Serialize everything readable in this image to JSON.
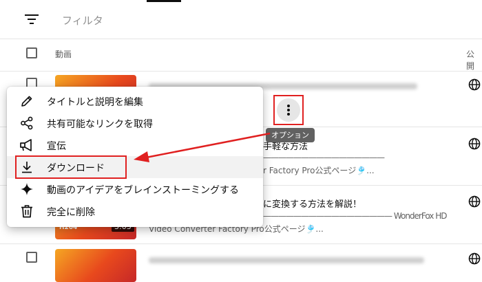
{
  "toolbar": {
    "filter_placeholder": "フィルタ"
  },
  "table": {
    "col_video": "動画",
    "col_visibility": "公開"
  },
  "rows": [
    {
      "title": "",
      "desc": ""
    },
    {
      "title": "手軽な方法",
      "desc": "————————————————",
      "desc2": "r Factory Pro公式ページ🎐..."
    },
    {
      "title": "に変換する方法を解説！",
      "desc": "————————————————— WonderFox HD",
      "desc2": "Video Converter Factory Pro公式ページ🎐...",
      "duration": "3:03"
    },
    {
      "title": "",
      "desc": ""
    }
  ],
  "menu": {
    "items": [
      {
        "label": "タイトルと説明を編集",
        "icon": "pencil-icon"
      },
      {
        "label": "共有可能なリンクを取得",
        "icon": "share-icon"
      },
      {
        "label": "宣伝",
        "icon": "megaphone-icon"
      },
      {
        "label": "ダウンロード",
        "icon": "download-icon"
      },
      {
        "label": "動画のアイデアをブレインストーミングする",
        "icon": "sparkle-icon"
      },
      {
        "label": "完全に削除",
        "icon": "trash-icon"
      }
    ]
  },
  "options_tooltip": "オプション",
  "colors": {
    "highlight": "#e02020",
    "menu_hover": "#f2f2f2",
    "tooltip": "#616161"
  }
}
